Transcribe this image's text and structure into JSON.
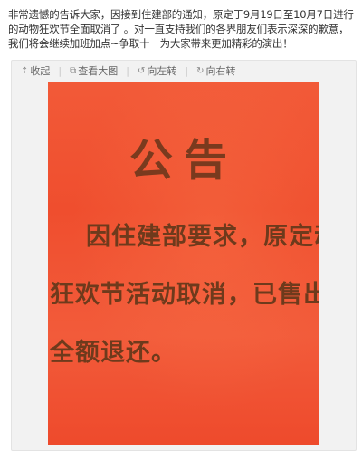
{
  "post": {
    "text": "非常遗憾的告诉大家，因接到住建部的通知，原定于9月19日至10月7日进行的动物狂欢节全面取消了 。对一直支持我们的各界朋友们表示深深的歉意，我们将会继续加班加点~争取十一为大家带来更加精彩的演出！"
  },
  "toolbar": {
    "collapse_label": "收起",
    "view_large_label": "查看大图",
    "rotate_left_label": "向左转",
    "rotate_right_label": "向右转",
    "collapse_icon": "up-arrow-icon",
    "view_large_icon": "external-link-icon",
    "rotate_left_icon": "rotate-left-icon",
    "rotate_right_icon": "rotate-right-icon"
  },
  "image": {
    "title": "公告",
    "line1": "因住建部要求，原定动物",
    "line2": "狂欢节活动取消，已售出门票",
    "line3": "全额退还。",
    "background_color": "#f05434",
    "text_color": "#6e3a1c"
  }
}
